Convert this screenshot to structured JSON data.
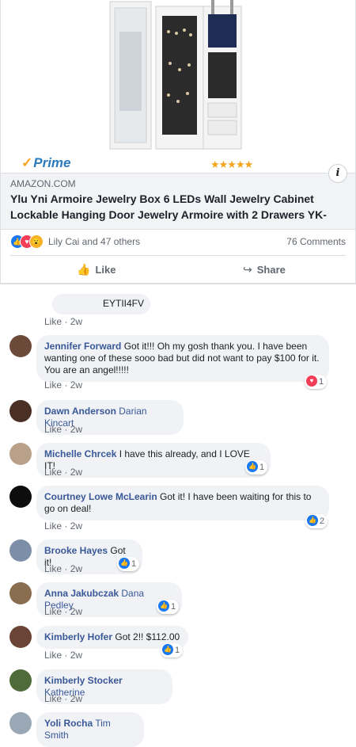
{
  "post": {
    "prime_label": "Prime",
    "prime_check": "✓",
    "stars": "★★★★★",
    "domain": "AMAZON.COM",
    "title": "Ylu Yni Armoire Jewelry Box 6 LEDs Wall Jewelry Cabinet Lockable Hanging Door Jewelry Armoire with 2 Drawers YK-",
    "info_icon": "i",
    "reactors": "Lily Cai and 47 others",
    "comment_count": "76 Comments",
    "like_label": "Like",
    "share_label": "Share"
  },
  "comments": [
    {
      "author": "",
      "text": "EYTII4FV",
      "like": "Like",
      "time": "2w",
      "reaction_count": ""
    },
    {
      "author": "Jennifer Forward",
      "text": "Got it!!! Oh my gosh thank you. I have been wanting one of these sooo bad but did not want to pay $100 for it. You are an angel!!!!!",
      "like": "Like",
      "time": "2w",
      "reaction_count": "1",
      "reaction": "love"
    },
    {
      "author": "Dawn Anderson",
      "tag": "Darian Kincart",
      "like": "Like",
      "time": "2w"
    },
    {
      "author": "Michelle Chrcek",
      "text": "I have this already, and I LOVE IT!",
      "like": "Like",
      "time": "2w",
      "reaction_count": "1",
      "reaction": "like"
    },
    {
      "author": "Courtney Lowe McLearin",
      "text": "Got it! I have been waiting for this to go on deal!",
      "like": "Like",
      "time": "2w",
      "reaction_count": "2",
      "reaction": "like"
    },
    {
      "author": "Brooke Hayes",
      "text": "Got it!",
      "like": "Like",
      "time": "2w",
      "reaction_count": "1",
      "reaction": "like"
    },
    {
      "author": "Anna Jakubczak",
      "tag": "Dana Pedley",
      "like": "Like",
      "time": "2w",
      "reaction_count": "1",
      "reaction": "like"
    },
    {
      "author": "Kimberly Hofer",
      "text": "Got 2!! $112.00",
      "like": "Like",
      "time": "2w",
      "reaction_count": "1",
      "reaction": "like"
    },
    {
      "author": "Kimberly Stocker",
      "tag": "Katherine",
      "like": "Like",
      "time": "2w"
    },
    {
      "author": "Yoli Rocha",
      "tag": "Tim Smith"
    }
  ],
  "separator": "·",
  "colors": {
    "link": "#385898",
    "like_blue": "#1877f2",
    "love_red": "#f33e58",
    "star": "#f4a51c"
  }
}
